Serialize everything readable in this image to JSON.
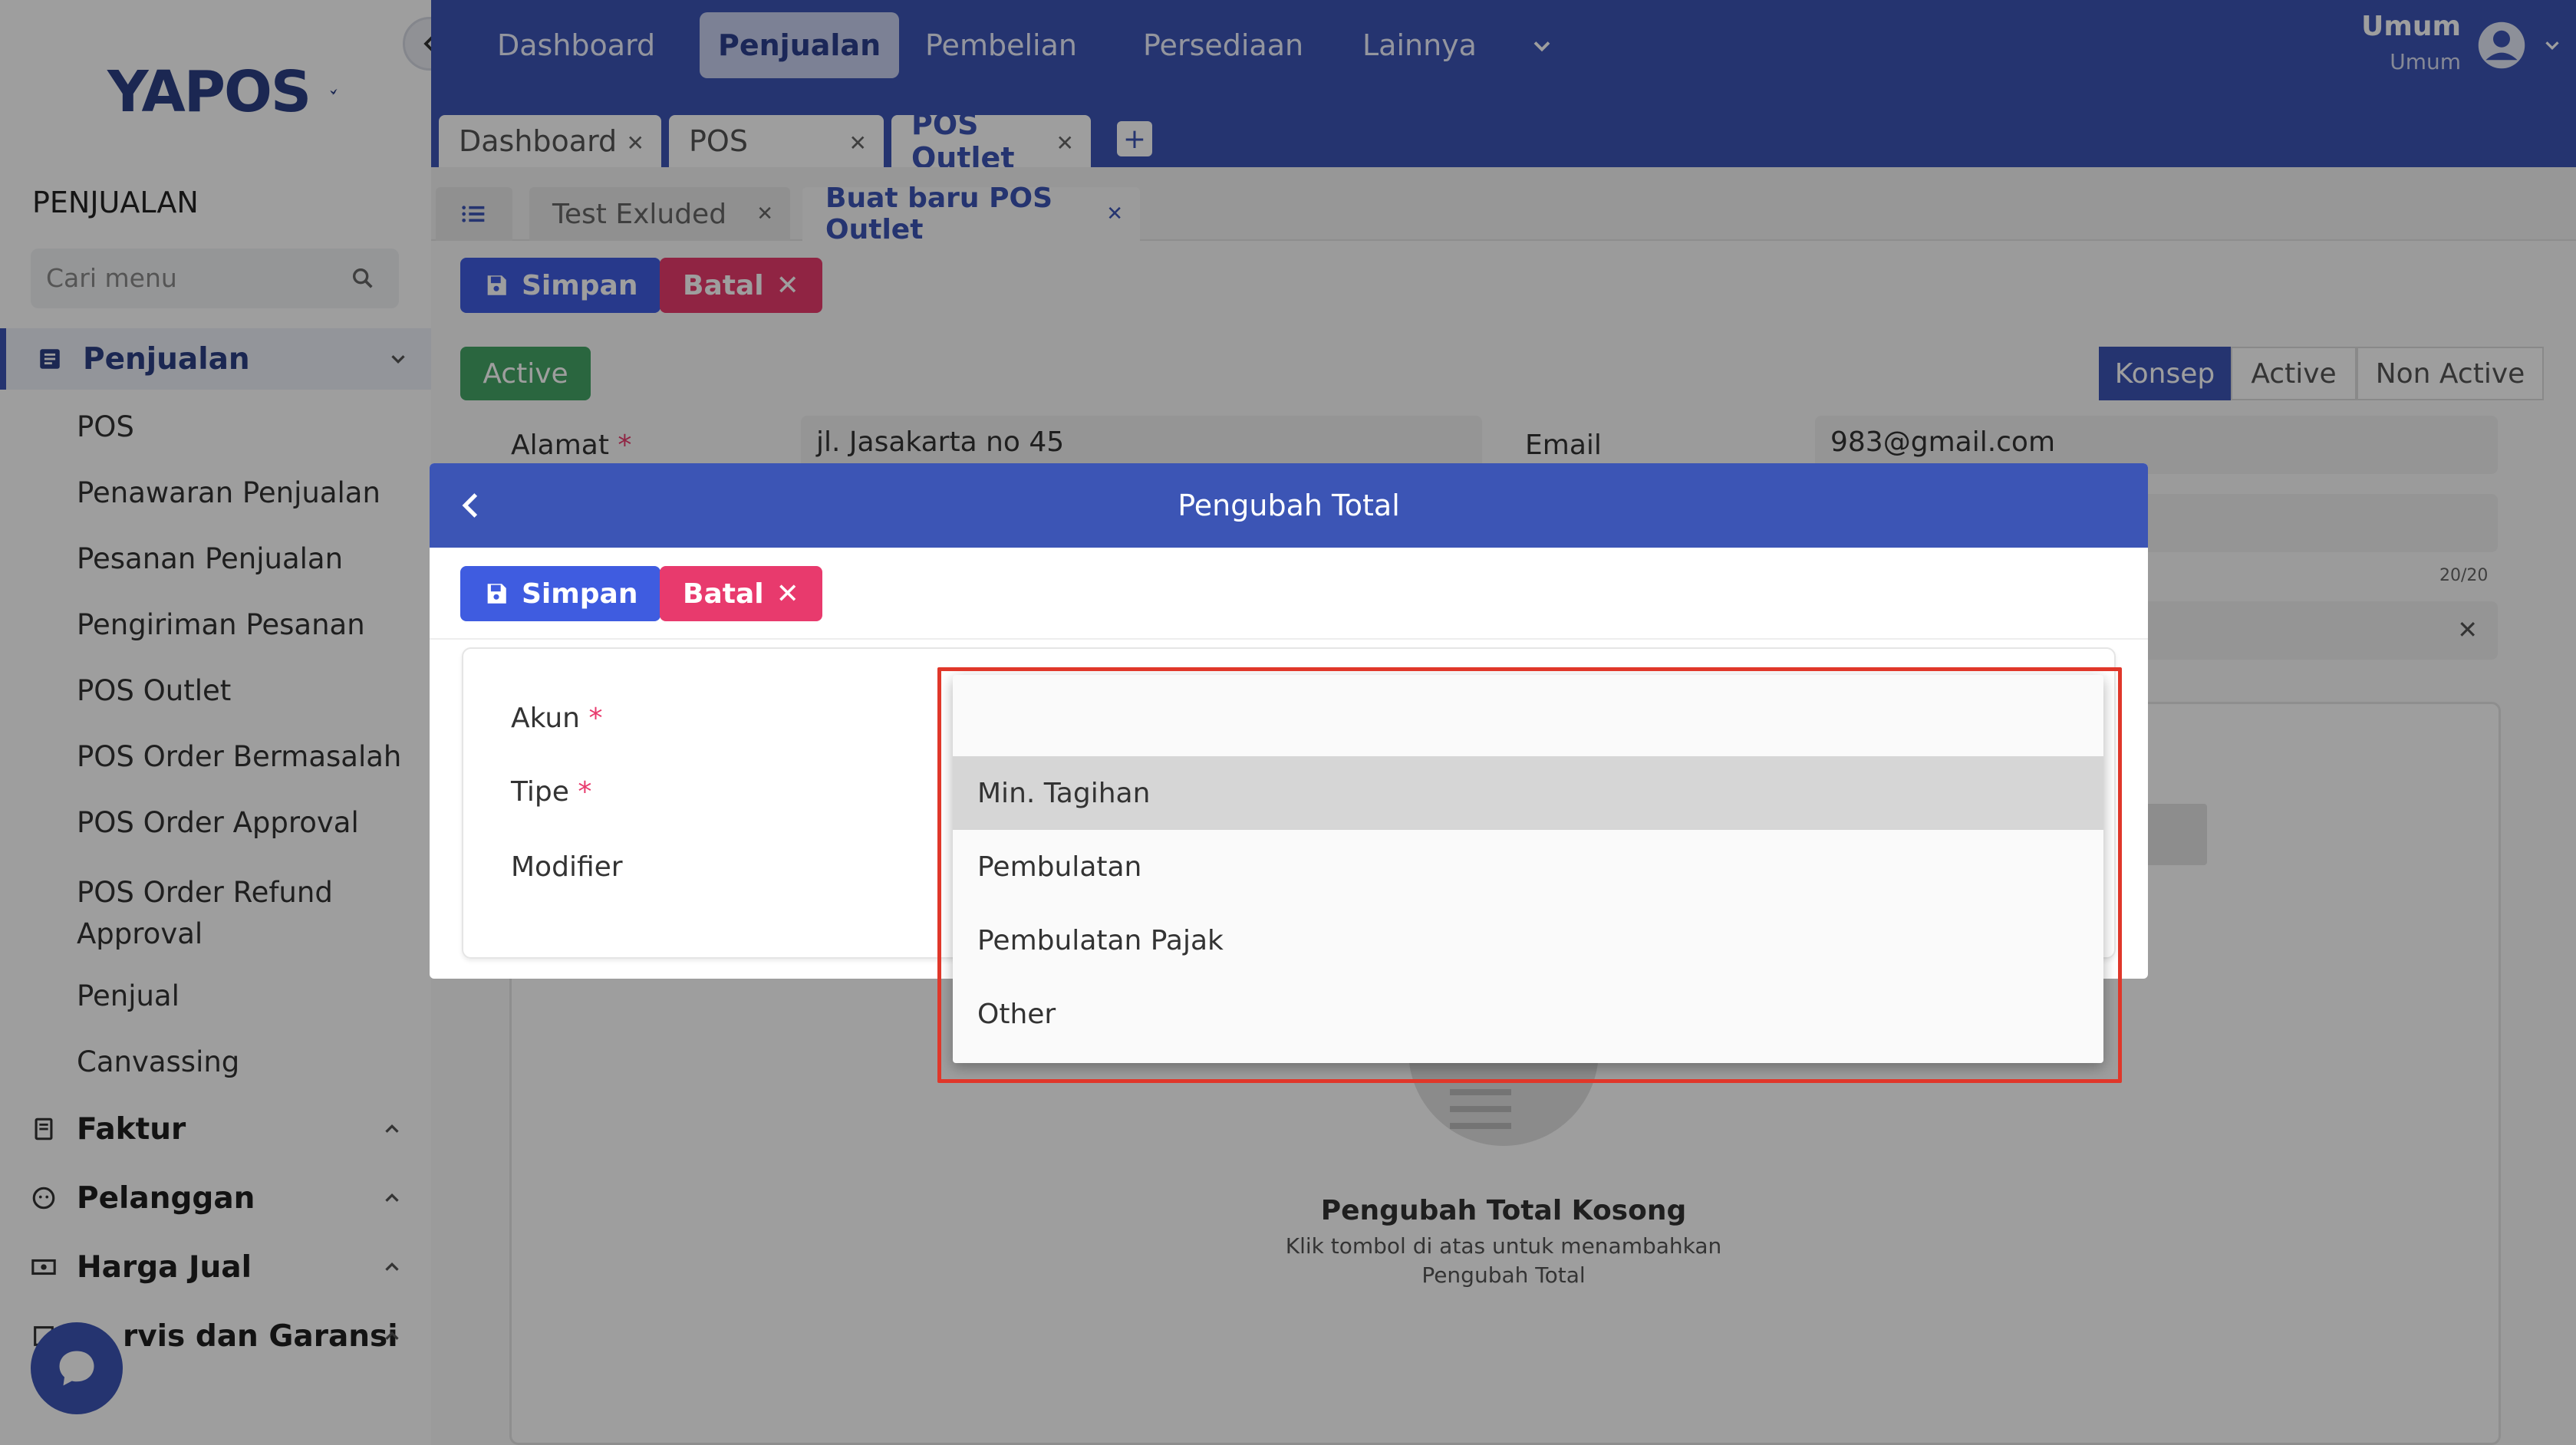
{
  "brand": {
    "name": "YAPOS"
  },
  "sidebar": {
    "heading": "PENJUALAN",
    "search_placeholder": "Cari menu",
    "groups": [
      {
        "label": "Penjualan"
      },
      {
        "label": "Faktur"
      },
      {
        "label": "Pelanggan"
      },
      {
        "label": "Harga Jual"
      },
      {
        "label": "rvis dan Garansi"
      }
    ],
    "items": [
      "POS",
      "Penawaran Penjualan",
      "Pesanan Penjualan",
      "Pengiriman Pesanan",
      "POS Outlet",
      "POS Order Bermasalah",
      "POS Order Approval",
      "POS Order Refund Approval",
      "Penjual",
      "Canvassing"
    ]
  },
  "topnav": {
    "items": [
      "Dashboard",
      "Penjualan",
      "Pembelian",
      "Persediaan",
      "Lainnya"
    ],
    "user_name": "Umum",
    "user_role": "Umum"
  },
  "tabs": [
    "Dashboard",
    "POS",
    "POS Outlet"
  ],
  "subtabs": [
    "Test Exluded",
    "Buat baru POS Outlet"
  ],
  "toolbar": {
    "save_label": "Simpan",
    "cancel_label": "Batal"
  },
  "status": {
    "badge": "Active",
    "steps": [
      "Konsep",
      "Active",
      "Non Active"
    ]
  },
  "background_form": {
    "alamat_label": "Alamat",
    "alamat_value": "jl. Jasakarta no 45",
    "email_label": "Email",
    "email_value": "983@gmail.com",
    "counter": "20/20"
  },
  "empty_state": {
    "title": "Pengubah Total Kosong",
    "subtitle": "Klik tombol di atas untuk menambahkan Pengubah Total"
  },
  "modal": {
    "title": "Pengubah Total",
    "save_label": "Simpan",
    "cancel_label": "Batal",
    "fields": [
      {
        "label": "Akun",
        "required": true
      },
      {
        "label": "Tipe",
        "required": true
      },
      {
        "label": "Modifier",
        "required": false
      }
    ],
    "required_mark": "*"
  },
  "dropdown": {
    "options": [
      "",
      "Min. Tagihan",
      "Pembulatan",
      "Pembulatan Pajak",
      "Other"
    ],
    "highlighted_index": 1
  },
  "colors": {
    "primary": "#3c55b5",
    "save": "#3f5ce0",
    "cancel": "#e83a6d",
    "active": "#45a567",
    "highlight_box": "#e0372a"
  }
}
